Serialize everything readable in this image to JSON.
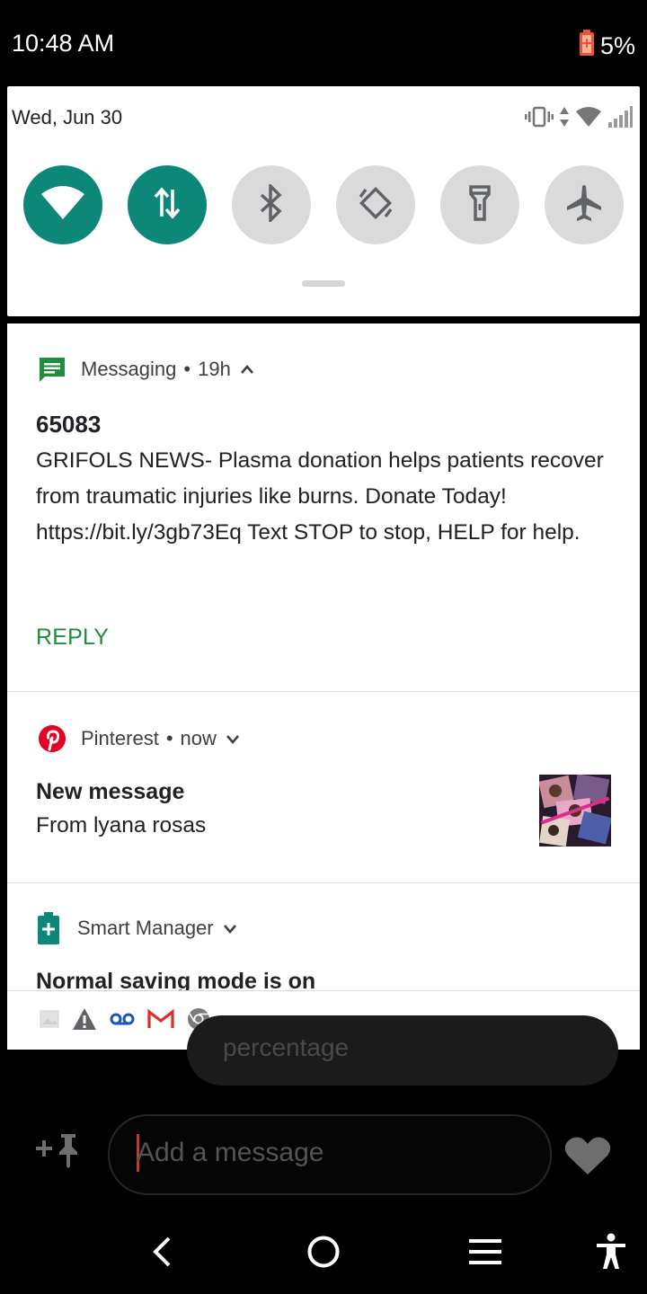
{
  "status_bar": {
    "time": "10:48 AM",
    "battery": "5%"
  },
  "quick_settings": {
    "date": "Wed, Jun 30",
    "tiles": [
      {
        "name": "wifi",
        "state": "on",
        "icon": "wifi-icon"
      },
      {
        "name": "mobile-data",
        "state": "on",
        "icon": "data-arrows-icon"
      },
      {
        "name": "bluetooth",
        "state": "off",
        "icon": "bluetooth-icon"
      },
      {
        "name": "auto-rotate",
        "state": "off",
        "icon": "rotate-icon"
      },
      {
        "name": "flashlight",
        "state": "off",
        "icon": "flashlight-icon"
      },
      {
        "name": "airplane-mode",
        "state": "off",
        "icon": "airplane-icon"
      }
    ]
  },
  "notifications": {
    "messaging": {
      "app": "Messaging",
      "time": "19h",
      "title": "65083",
      "body": "GRIFOLS NEWS- Plasma donation helps patients recover from traumatic injuries like burns. Donate Today! https://bit.ly/3gb73Eq Text STOP to stop, HELP for help.",
      "action": "REPLY"
    },
    "pinterest": {
      "app": "Pinterest",
      "time": "now",
      "title": "New message",
      "subtitle": "From lyana rosas"
    },
    "smart_manager": {
      "app": "Smart Manager",
      "title": "Normal saving mode is on"
    },
    "overflow_icons": [
      "image-icon",
      "warning-icon",
      "voicemail-icon",
      "gmail-icon",
      "chrome-icon"
    ]
  },
  "background_app": {
    "pill_text": "percentage",
    "input_placeholder": "Add a message"
  },
  "colors": {
    "accent": "#0d8778",
    "reply": "#1e8e3e",
    "pinterest": "#e60023",
    "messaging": "#1e8e3e"
  }
}
